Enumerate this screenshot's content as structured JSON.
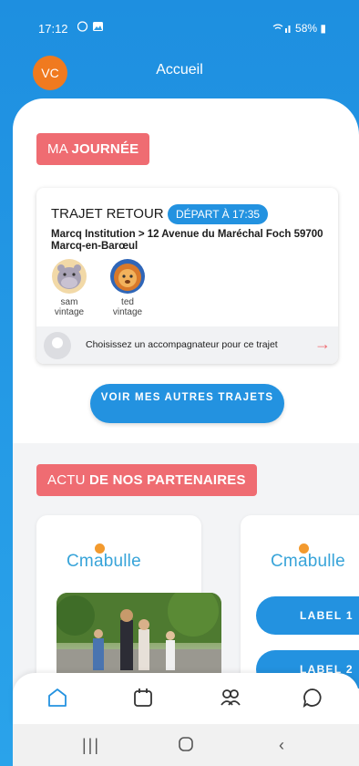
{
  "status_bar": {
    "time": "17:12",
    "battery": "58%"
  },
  "header": {
    "avatar_initials": "VC",
    "title": "Accueil"
  },
  "my_day": {
    "tag_prefix": "MA",
    "tag_bold": "JOURNÉE",
    "trip": {
      "title": "TRAJET RETOUR",
      "badge": "DÉPART À 17:35",
      "route": "Marcq Institution > 12 Avenue du Maréchal Foch 59700 Marcq-en-Barœul",
      "children": [
        {
          "first": "sam",
          "last": "vintage",
          "icon": "hippo-avatar"
        },
        {
          "first": "ted",
          "last": "vintage",
          "icon": "lion-avatar"
        }
      ],
      "companion_prompt": "Choisissez un accompagnateur pour ce trajet"
    },
    "more_trips_button": "VOIR MES AUTRES TRAJETS"
  },
  "partners": {
    "tag_prefix": "ACTU",
    "tag_bold": "DE NOS PARTENAIRES",
    "cards": [
      {
        "logo": "Cmabulle"
      },
      {
        "logo": "Cmabulle",
        "buttons": [
          "LABEL 1",
          "LABEL 2"
        ]
      }
    ]
  },
  "bottom_nav": [
    "home-icon",
    "calendar-icon",
    "group-icon",
    "chat-icon"
  ],
  "colors": {
    "primary": "#2392e0",
    "accent": "#ef6c72",
    "avatar": "#f07a1f"
  }
}
